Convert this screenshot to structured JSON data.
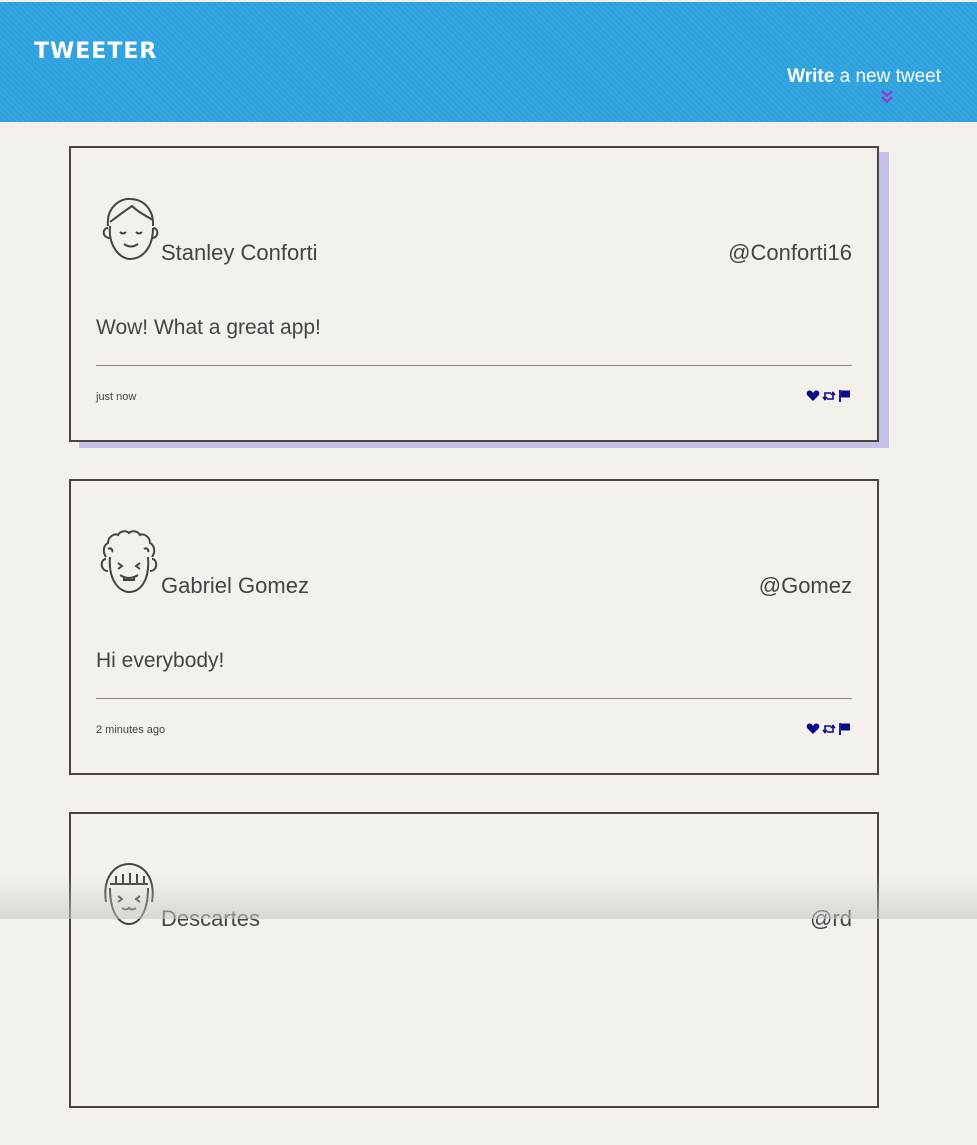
{
  "nav": {
    "brand": "TWEETER",
    "compose_bold": "Write",
    "compose_rest": " a new tweet"
  },
  "colors": {
    "nav_bg": "#2fa3e0",
    "page_bg": "#f4f1ec",
    "action_icons": "#0b0b8a",
    "chevron": "#a12fd6",
    "active_shadow": "#c6c1e8"
  },
  "tweets": [
    {
      "name": "Stanley Conforti",
      "handle": "@Conforti16",
      "text": "Wow! What a great app!",
      "time": "just now",
      "avatar_icon": "boy-avatar-icon"
    },
    {
      "name": "Gabriel Gomez",
      "handle": "@Gomez",
      "text": "Hi everybody!",
      "time": "2 minutes ago",
      "avatar_icon": "curly-hair-avatar-icon"
    },
    {
      "name": "Descartes",
      "handle": "@rd",
      "text": "",
      "time": "",
      "avatar_icon": "girl-avatar-icon"
    }
  ]
}
